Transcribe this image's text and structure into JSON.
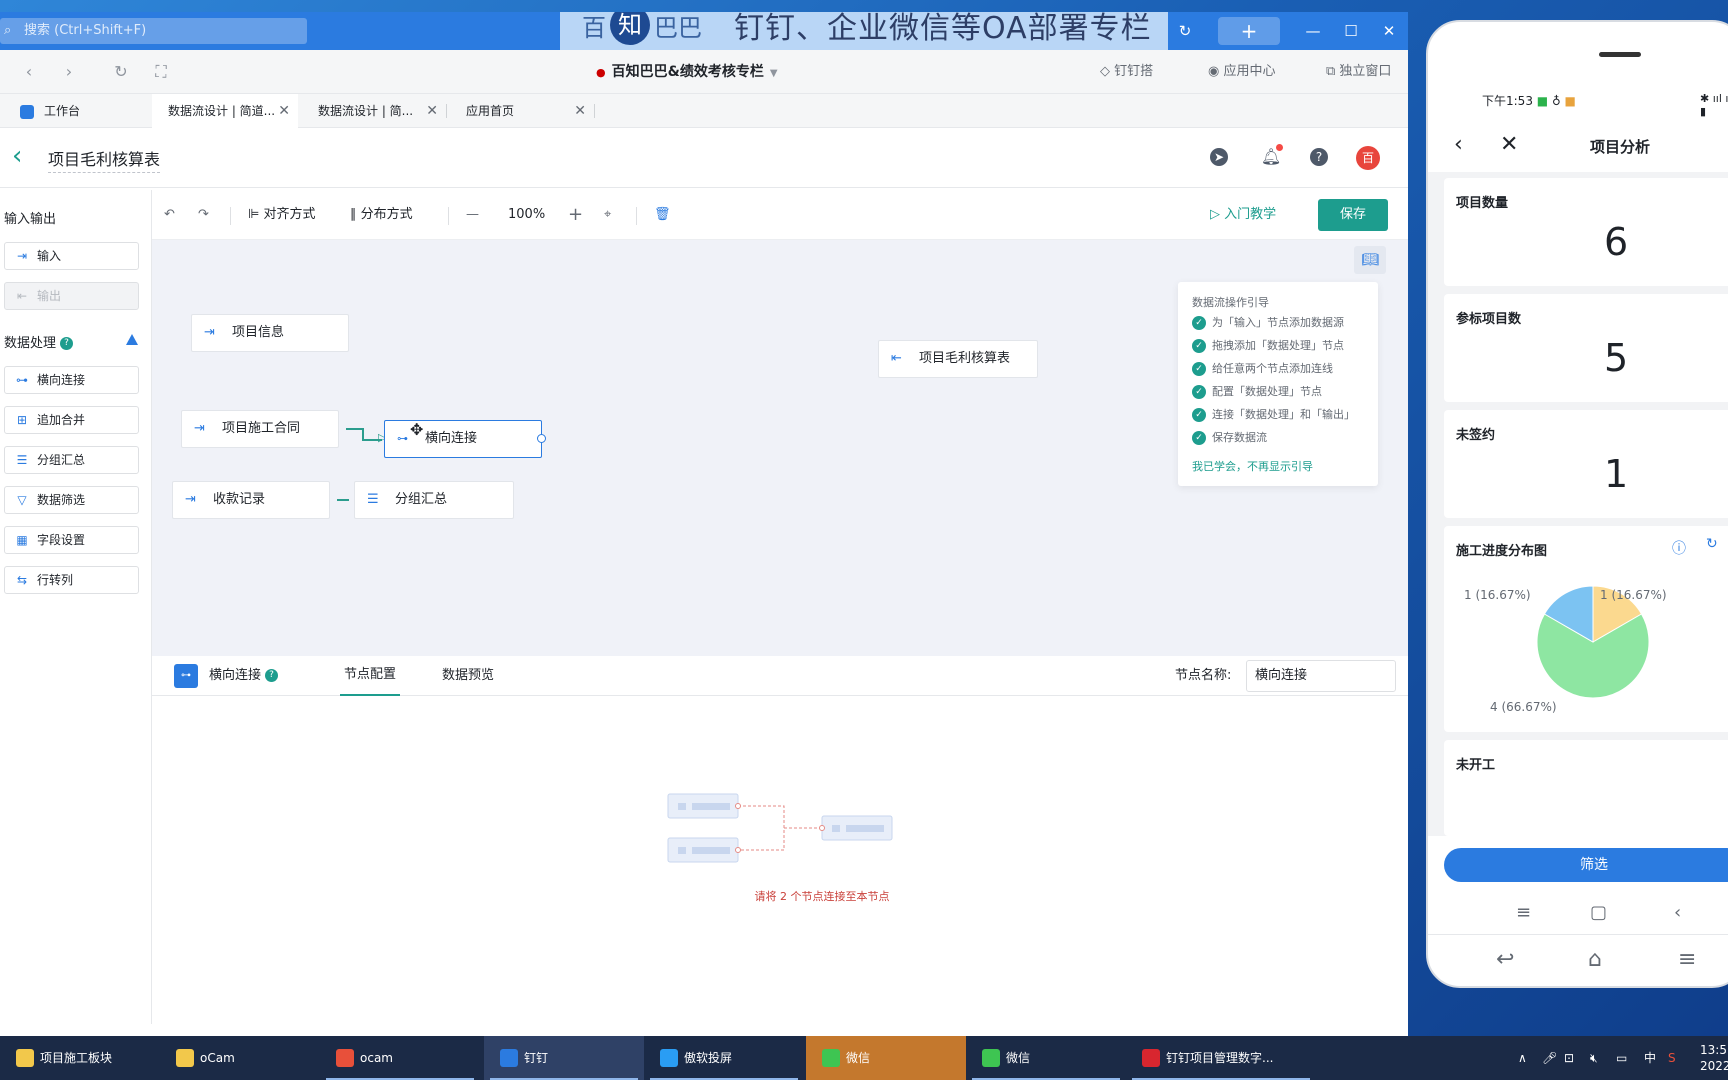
{
  "titlebar": {
    "search_placeholder": "搜索 (Ctrl+Shift+F)",
    "banner_logo": "百知巴巴",
    "banner_slogan": "钉钉、企业微信等OA部署专栏"
  },
  "navbar": {
    "center_title": "百知巴巴&绩效考核专栏",
    "links": [
      "钉钉搭",
      "应用中心",
      "独立窗口"
    ]
  },
  "tabs": [
    {
      "label": "工作台"
    },
    {
      "label": "数据流设计 | 简道..."
    },
    {
      "label": "数据流设计 | 简..."
    },
    {
      "label": "应用首页"
    }
  ],
  "header": {
    "title": "项目毛利核算表",
    "avatar_text": "百"
  },
  "left_panel": {
    "io_title": "输入输出",
    "io_items": [
      "输入",
      "输出"
    ],
    "processing_title": "数据处理",
    "processing_items": [
      "横向连接",
      "追加合并",
      "分组汇总",
      "数据筛选",
      "字段设置",
      "行转列"
    ]
  },
  "toolbar": {
    "align": "对齐方式",
    "distribute": "分布方式",
    "zoom": "100%",
    "tutorial": "入门教学",
    "save": "保存"
  },
  "canvas": {
    "nodes": {
      "project_info": "项目信息",
      "contract": "项目施工合同",
      "join": "横向连接",
      "payments": "收款记录",
      "group": "分组汇总",
      "output": "项目毛利核算表"
    }
  },
  "guide": {
    "title": "数据流操作引导",
    "steps": [
      "为「输入」节点添加数据源",
      "拖拽添加「数据处理」节点",
      "给任意两个节点添加连线",
      "配置「数据处理」节点",
      "连接「数据处理」和「输出」",
      "保存数据流"
    ],
    "dismiss": "我已学会，不再显示引导"
  },
  "config": {
    "node_type": "横向连接",
    "tab_config": "节点配置",
    "tab_preview": "数据预览",
    "name_label": "节点名称:",
    "name_value": "横向连接",
    "hint": "请将 2 个节点连接至本节点"
  },
  "taskbar": {
    "items": [
      "项目施工板块",
      "oCam",
      "ocam",
      "钉钉",
      "傲软投屏",
      "微信",
      "微信",
      "钉钉项目管理数字..."
    ],
    "tray_ime": "中",
    "clock": "13:5",
    "date": "2022"
  },
  "phone": {
    "status_time": "下午1:53",
    "title": "项目分析",
    "cards": [
      {
        "label": "项目数量",
        "value": "6"
      },
      {
        "label": "参标项目数",
        "value": "5"
      },
      {
        "label": "未签约",
        "value": "1"
      }
    ],
    "chart_title": "施工进度分布图",
    "next_card": "未开工",
    "filter_button": "筛选"
  },
  "chart_data": {
    "type": "pie",
    "title": "施工进度分布图",
    "values": [
      1,
      4,
      1
    ],
    "labels": [
      "1 (16.67%)",
      "4 (66.67%)",
      "1 (16.67%)"
    ],
    "colors": [
      "#7cc3f2",
      "#8ee6a2",
      "#fbd98f"
    ]
  },
  "colors": {
    "accent": "#1d9d8e",
    "brand_blue": "#2b7be0",
    "canvas_bg": "#f0f2f8"
  }
}
